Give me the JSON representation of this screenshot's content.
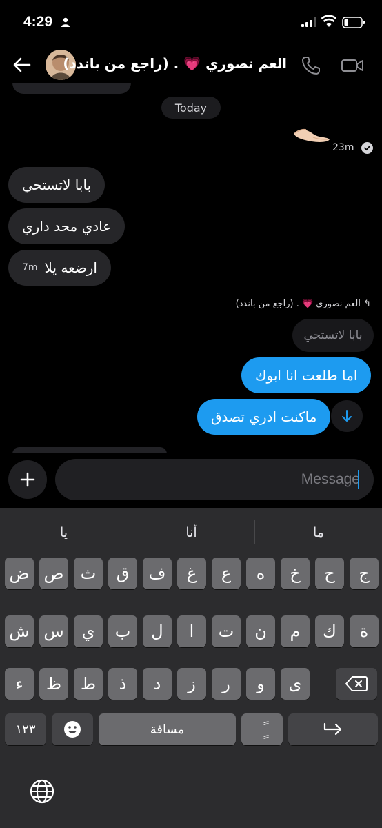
{
  "status_bar": {
    "time": "4:29"
  },
  "header": {
    "contact_name": "العم نصوري 💗 . (راجع من باندد)"
  },
  "chat": {
    "date_divider": "Today",
    "emoji_message": "🫴🏻",
    "sent_time": "23m",
    "incoming": [
      {
        "text": "بابا لاتستحي"
      },
      {
        "text": "عادي محد داري"
      },
      {
        "text": "ارضعه يلا",
        "time": "7m"
      }
    ],
    "reply_to_label": "العم نصوري 💗 . (راجع من باندد)",
    "reply_quote": "بابا لاتستحي",
    "outgoing": [
      {
        "text": "اما طلعت انا ابوك"
      },
      {
        "text": "ماكنت ادري تصدق"
      }
    ]
  },
  "composer": {
    "placeholder": "Message"
  },
  "keyboard": {
    "suggestions": [
      "ما",
      "أنا",
      "يا"
    ],
    "row1": [
      "ض",
      "ص",
      "ث",
      "ق",
      "ف",
      "غ",
      "ع",
      "ه",
      "خ",
      "ح",
      "ج"
    ],
    "row2": [
      "ش",
      "س",
      "ي",
      "ب",
      "ل",
      "ا",
      "ت",
      "ن",
      "م",
      "ك",
      "ة"
    ],
    "row3": [
      "ء",
      "ظ",
      "ط",
      "ذ",
      "د",
      "ز",
      "ر",
      "و",
      "ى"
    ],
    "numbers_key": "١٢٣",
    "space_key": "مسافة",
    "diacritic_key": "ًٍ"
  },
  "colors": {
    "accent": "#1d9bf0",
    "bubble_incoming": "#262629",
    "keyboard_bg": "#2c2c2e"
  }
}
